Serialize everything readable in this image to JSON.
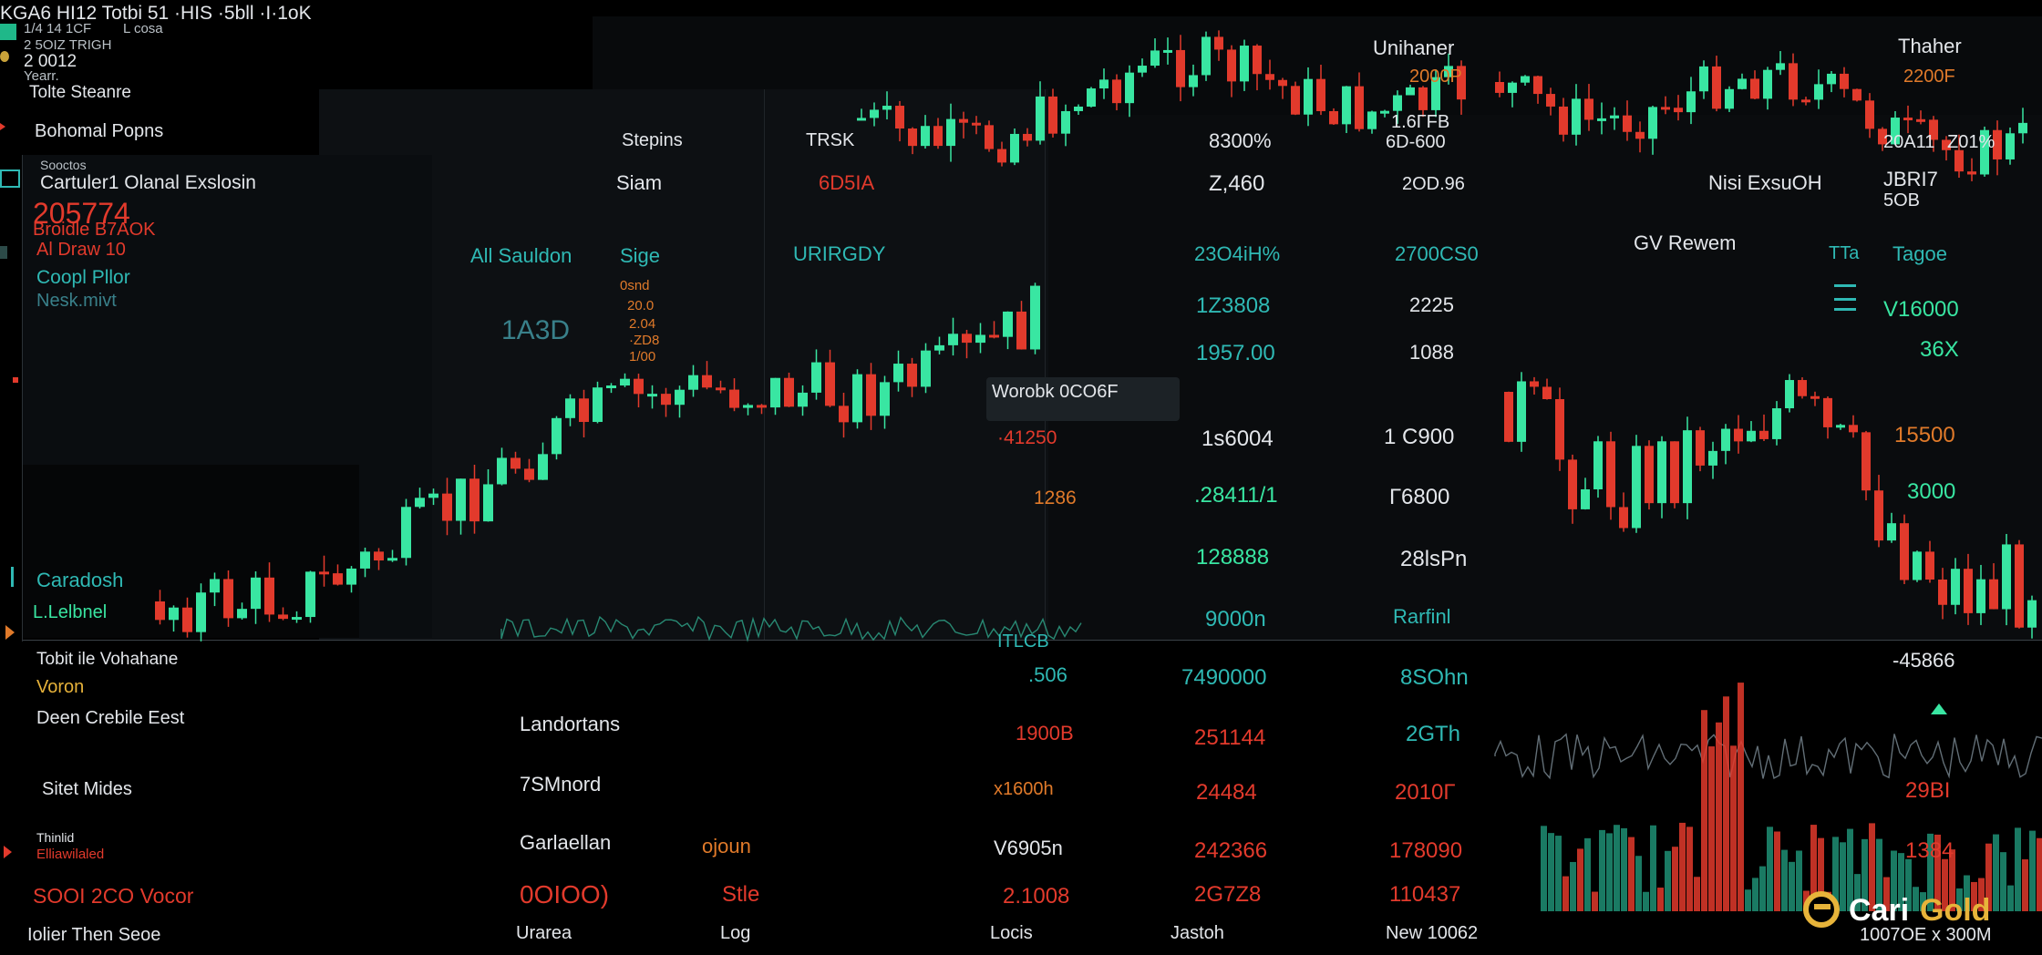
{
  "header": {
    "title": "KGA6 HI12 Totbi 51 ·HIS ·5bll ·I·1oK",
    "sub1": "1/4 14 1CF",
    "sub1b": "L cosa",
    "sub2": "2 5OIZ TRIGH",
    "sub3": "2 0012",
    "sub4": "Yearr.",
    "sub5": "Tolte Steanre"
  },
  "left": {
    "popular": "Bohomal Popns",
    "section_small": "Sooctos",
    "section": "Cartuler1 Olanal Exslosin",
    "price_big": "205774",
    "price_sub": "Broidle B7AOK",
    "price_sub2": "Al Draw 10",
    "coopl": "Coopl Pllor",
    "neslmivt": "Nesk.mivt",
    "caradosh": "Caradosh",
    "label": "L.Lelbnel",
    "tobit": "Tobit ile Vohahane",
    "voron": "Voron",
    "deen": "Deen Crebile Eest",
    "sitc": "Sitet Mides",
    "foot_small": "Thinlid",
    "foot_small2": "Elliawilaled",
    "soi": "SOOI 2CO Vocor",
    "bottom": "Iolier Then Seoe"
  },
  "table": {
    "stepins": "Stepins",
    "stepins_val": "TRSK",
    "siam": "Siam",
    "siam_val": "6D5IA",
    "c1_head": "All Sauldon",
    "c2_head": "Sige",
    "c3_head": "URIRGDY",
    "left_small": [
      "0snd",
      "20.0",
      "2.04",
      "·ZD8",
      "1/00"
    ],
    "left_big": "1A3D",
    "widget": "Worobk 0CO6F",
    "col_a": [
      "·41250",
      "1286",
      "ITLCB",
      ".506",
      "1900B",
      "x1600h",
      "V6905n",
      "2.1008"
    ],
    "col_b": [
      "8300%",
      "Z,460",
      "23O4iH%",
      "1Z3808",
      "1957.00",
      "1s6004",
      ".28411/1",
      "128888",
      "9000n",
      "7490000",
      "251144",
      "24484",
      "242366",
      "2G7Z8"
    ],
    "col_c": [
      "1.6ГFB",
      "6D-600",
      "2OD.96",
      "2700CS0",
      "2225",
      "1088",
      "1 C900",
      "Г6800",
      "28lsPn",
      "Rarfinl",
      "8SOhn",
      "2GTh",
      "2010Г",
      "178090",
      "110437"
    ],
    "landortans": "Landortans",
    "ssmoord": "7SMnord",
    "garlaellan": "Garlaellan",
    "opn": "ojoun",
    "stle": "Stle",
    "tooo": "0OIOO)",
    "bottom_uaresa": "Urarea",
    "bottom_log": "Log",
    "bottom_locis": "Locis",
    "bottom_jastoh": "Jastoh",
    "bottom_new": "New 10062"
  },
  "right": {
    "unihaner": "Unihaner",
    "thaher": "Thaher",
    "top_vals": [
      "2000P",
      "2200F"
    ],
    "mid_vals": [
      "20A11",
      "Z01%"
    ],
    "nisi": "Nisi ExsuOH",
    "jbr": "JBRI7",
    "jbr2": "5OB",
    "gv": "GV Rewem",
    "ttle": "TTa",
    "tagoe": "Tagoe",
    "v1": "V16000",
    "v2": "36X",
    "v3": "15500",
    "v4": "3000",
    "v5": "-45866",
    "v6": "29BI",
    "v7": "1384",
    "foot": "1007OE x 300M"
  },
  "brand": {
    "name": "CariGold",
    "name_a": "Cari",
    "name_b": "Gold"
  },
  "colors": {
    "up": "#39e6a2",
    "down": "#e23a2c",
    "bg": "#000000",
    "panel": "#0c0f12",
    "accent": "#2fb9b4"
  }
}
